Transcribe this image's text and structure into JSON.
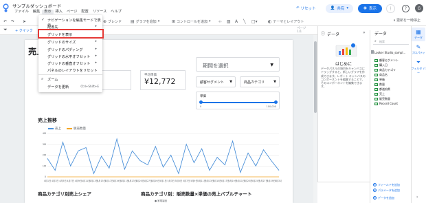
{
  "header": {
    "title": "サンプルダッシュボード",
    "menus": [
      "ファイル",
      "編集",
      "表示",
      "挿入",
      "ページ",
      "配置",
      "リソース",
      "ヘルプ"
    ],
    "active_menu_index": 2,
    "reset_label": "リセット",
    "share_label": "共有",
    "view_label": "表示",
    "avatar_letter": "G"
  },
  "toolbar": {
    "blend_label": "ブレンド",
    "add_chart_label": "グラフを追加",
    "add_control_label": "コントロールを追加",
    "theme_label": "テーマとレイアウト",
    "pause_label": "更新を一時停止"
  },
  "filterbar": {
    "add_quick_filter": "+ クイック",
    "right_line1": "ページ",
    "right_line2": "1/1"
  },
  "view_menu": {
    "items": [
      {
        "label": "ナビゲーションを編集モードで表示",
        "checked": true,
        "submenu": false,
        "shortcut": ""
      },
      {
        "label": "配置先",
        "checked": false,
        "submenu": true,
        "shortcut": ""
      },
      {
        "label": "グリッドを表示",
        "checked": false,
        "submenu": false,
        "shortcut": ""
      },
      {
        "label": "グリッドのサイズ",
        "checked": false,
        "submenu": true,
        "shortcut": ""
      },
      {
        "label": "グリッドのパディング",
        "checked": false,
        "submenu": true,
        "shortcut": ""
      },
      {
        "label": "グリッドの水平オフセット",
        "checked": false,
        "submenu": true,
        "shortcut": ""
      },
      {
        "label": "グリッドの垂直オフセット",
        "checked": false,
        "submenu": true,
        "shortcut": ""
      },
      {
        "label": "パネルのレイアウトをリセット",
        "checked": false,
        "submenu": false,
        "shortcut": ""
      },
      {
        "label": "ズーム",
        "checked": false,
        "submenu": true,
        "shortcut": "",
        "icon": "zoom-icon"
      },
      {
        "label": "データを更新",
        "checked": false,
        "submenu": false,
        "shortcut": "Ctrl+Shift+E"
      }
    ],
    "highlighted_index": 2
  },
  "report": {
    "page_title": "売上",
    "kpis": [
      {
        "label": "",
        "value": ""
      },
      {
        "label": "",
        "value": "7"
      },
      {
        "label": "平均単価",
        "value": "¥12,772"
      }
    ],
    "date_selector": "期間を選択",
    "control_1": "顧客セグメント",
    "control_2": "商品カテゴリ",
    "slider": {
      "label": "単価",
      "min_label": "0",
      "max_label": "100,000",
      "value": [
        0,
        100000
      ]
    },
    "chart_title": "売上推移",
    "section_2_title": "商品カテゴリ別売上シェア",
    "section_3_title": "商品カテゴリ別：販売数量×単価の売上バブルチャート",
    "section_3_legend": "● 家電製品"
  },
  "chart_data": {
    "type": "line",
    "title": "売上推移",
    "xlabel": "",
    "ylabel": "",
    "x": [
      "4月1日",
      "4月3日",
      "4月5日",
      "4月7日",
      "4月9日",
      "4月11日",
      "4月13日",
      "4月15日",
      "4月17日",
      "4月19日",
      "4月21日",
      "4月23日",
      "4月25日",
      "4月27日",
      "4月29日",
      "5月1日",
      "5月3日",
      "5月5日",
      "5月7日",
      "5月9日",
      "5月11日",
      "5月13日",
      "5月15日",
      "5月17日",
      "5月19日",
      "5月21日",
      "5月23日",
      "5月25日",
      "5月27日",
      "5月29日",
      "5月31日"
    ],
    "series": [
      {
        "name": "売上",
        "color": "#4a90d9",
        "values": [
          1700000,
          600000,
          3200000,
          1000000,
          2400000,
          2700000,
          300000,
          1900000,
          800000,
          3500000,
          700000,
          2400000,
          1500000,
          1100000,
          2800000,
          900000,
          2000000,
          300000,
          3000000,
          1300000,
          2600000,
          600000,
          1800000,
          1100000,
          3300000,
          400000,
          2200000,
          1000000,
          2500000,
          1500000,
          600000
        ]
      },
      {
        "name": "販売数量",
        "color": "#f5a623",
        "values": [
          0,
          0,
          0,
          0,
          0,
          0,
          0,
          0,
          0,
          0,
          0,
          0,
          0,
          0,
          0,
          0,
          0,
          0,
          0,
          0,
          0,
          0,
          0,
          0,
          0,
          0,
          0,
          0,
          0,
          0,
          0
        ]
      }
    ],
    "ylim": [
      0,
      4000000
    ],
    "yticks": [
      "4M",
      "3M",
      "2M",
      "1M",
      "0"
    ],
    "xticks": [
      "4月1日",
      "4月3日",
      "4月5日",
      "4月7日",
      "4月9日",
      "4月11日",
      "4月13日",
      "4月15日",
      "4月17日",
      "4月19日",
      "4月21日",
      "4月23日",
      "4月25日",
      "4月27日",
      "4月29日",
      "5月1日",
      "5月3日",
      "5月5日",
      "5月7日",
      "5月9日",
      "5月11日",
      "5月13日",
      "5月15日",
      "5月17日",
      "5月19日",
      "5月21日",
      "5月23日",
      "5月25日",
      "5月27日",
      "5月29日",
      "5月31日"
    ],
    "grid": true,
    "legend": "top-left"
  },
  "data_panel": {
    "title": "データ",
    "onboarding_title": "はじめに",
    "onboarding_text": "データパネルの項目をキャンバスにドラッグすると、新しいグラフを作成できます。レポート キャンバスのコンポーネントを編集することで、そのコンポーネントを編集できます。"
  },
  "fields_panel": {
    "title": "データ",
    "search_placeholder": "検索",
    "datasource": "Looker Studio_sampl...",
    "fields": [
      "顧客セグメント",
      "購入日",
      "商品カテゴリ",
      "商品名",
      "単価",
      "数量",
      "都道府県",
      "売上",
      "販売数量",
      "Record Count"
    ],
    "add_field": "フィールドを追加",
    "add_param": "パラメータを追加",
    "add_data": "データを追加"
  },
  "rail": {
    "data_label": "データ",
    "properties_label": "プロパティ",
    "filter_label": "フィルタ バー"
  },
  "colors": {
    "accent": "#1a73e8",
    "highlight_border": "#e53935",
    "series_sales": "#4a90d9",
    "series_qty": "#f5a623"
  }
}
